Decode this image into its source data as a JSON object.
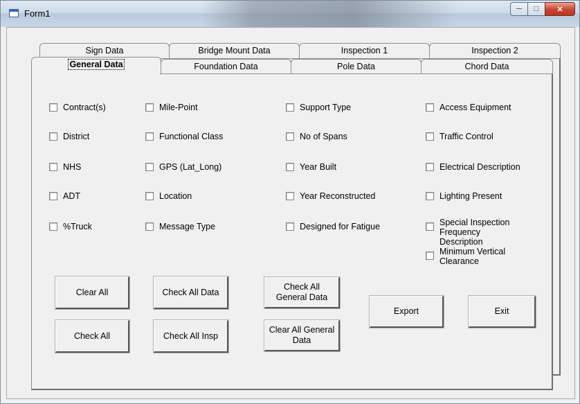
{
  "window": {
    "title": "Form1"
  },
  "caption_buttons": {
    "minimize": "minimize-icon",
    "maximize": "maximize-icon",
    "close": "close-icon"
  },
  "tabs_back": [
    "Sign Data",
    "Bridge Mount Data",
    "Inspection 1",
    "Inspection 2"
  ],
  "tabs_front": [
    "General Data",
    "Foundation Data",
    "Pole Data",
    "Chord Data"
  ],
  "active_tab": "General Data",
  "checkboxes": {
    "col1": [
      "Contract(s)",
      "District",
      "NHS",
      "ADT",
      "%Truck"
    ],
    "col2": [
      "Mile-Point",
      "Functional Class",
      "GPS (Lat_Long)",
      "Location",
      "Message Type"
    ],
    "col3": [
      "Support Type",
      "No of Spans",
      "Year Built",
      "Year Reconstructed",
      "Designed for Fatigue"
    ],
    "col4": [
      "Access Equipment",
      "Traffic Control",
      "Electrical Description",
      "Lighting Present",
      "Special Inspection Frequency Description",
      "Minimum Vertical Clearance"
    ]
  },
  "buttons": {
    "clear_all": "Clear All",
    "check_all": "Check All",
    "check_all_data": "Check All Data",
    "check_all_insp": "Check All Insp",
    "check_all_general": "Check All General Data",
    "clear_all_general": "Clear All General Data",
    "export": "Export",
    "exit": "Exit"
  }
}
